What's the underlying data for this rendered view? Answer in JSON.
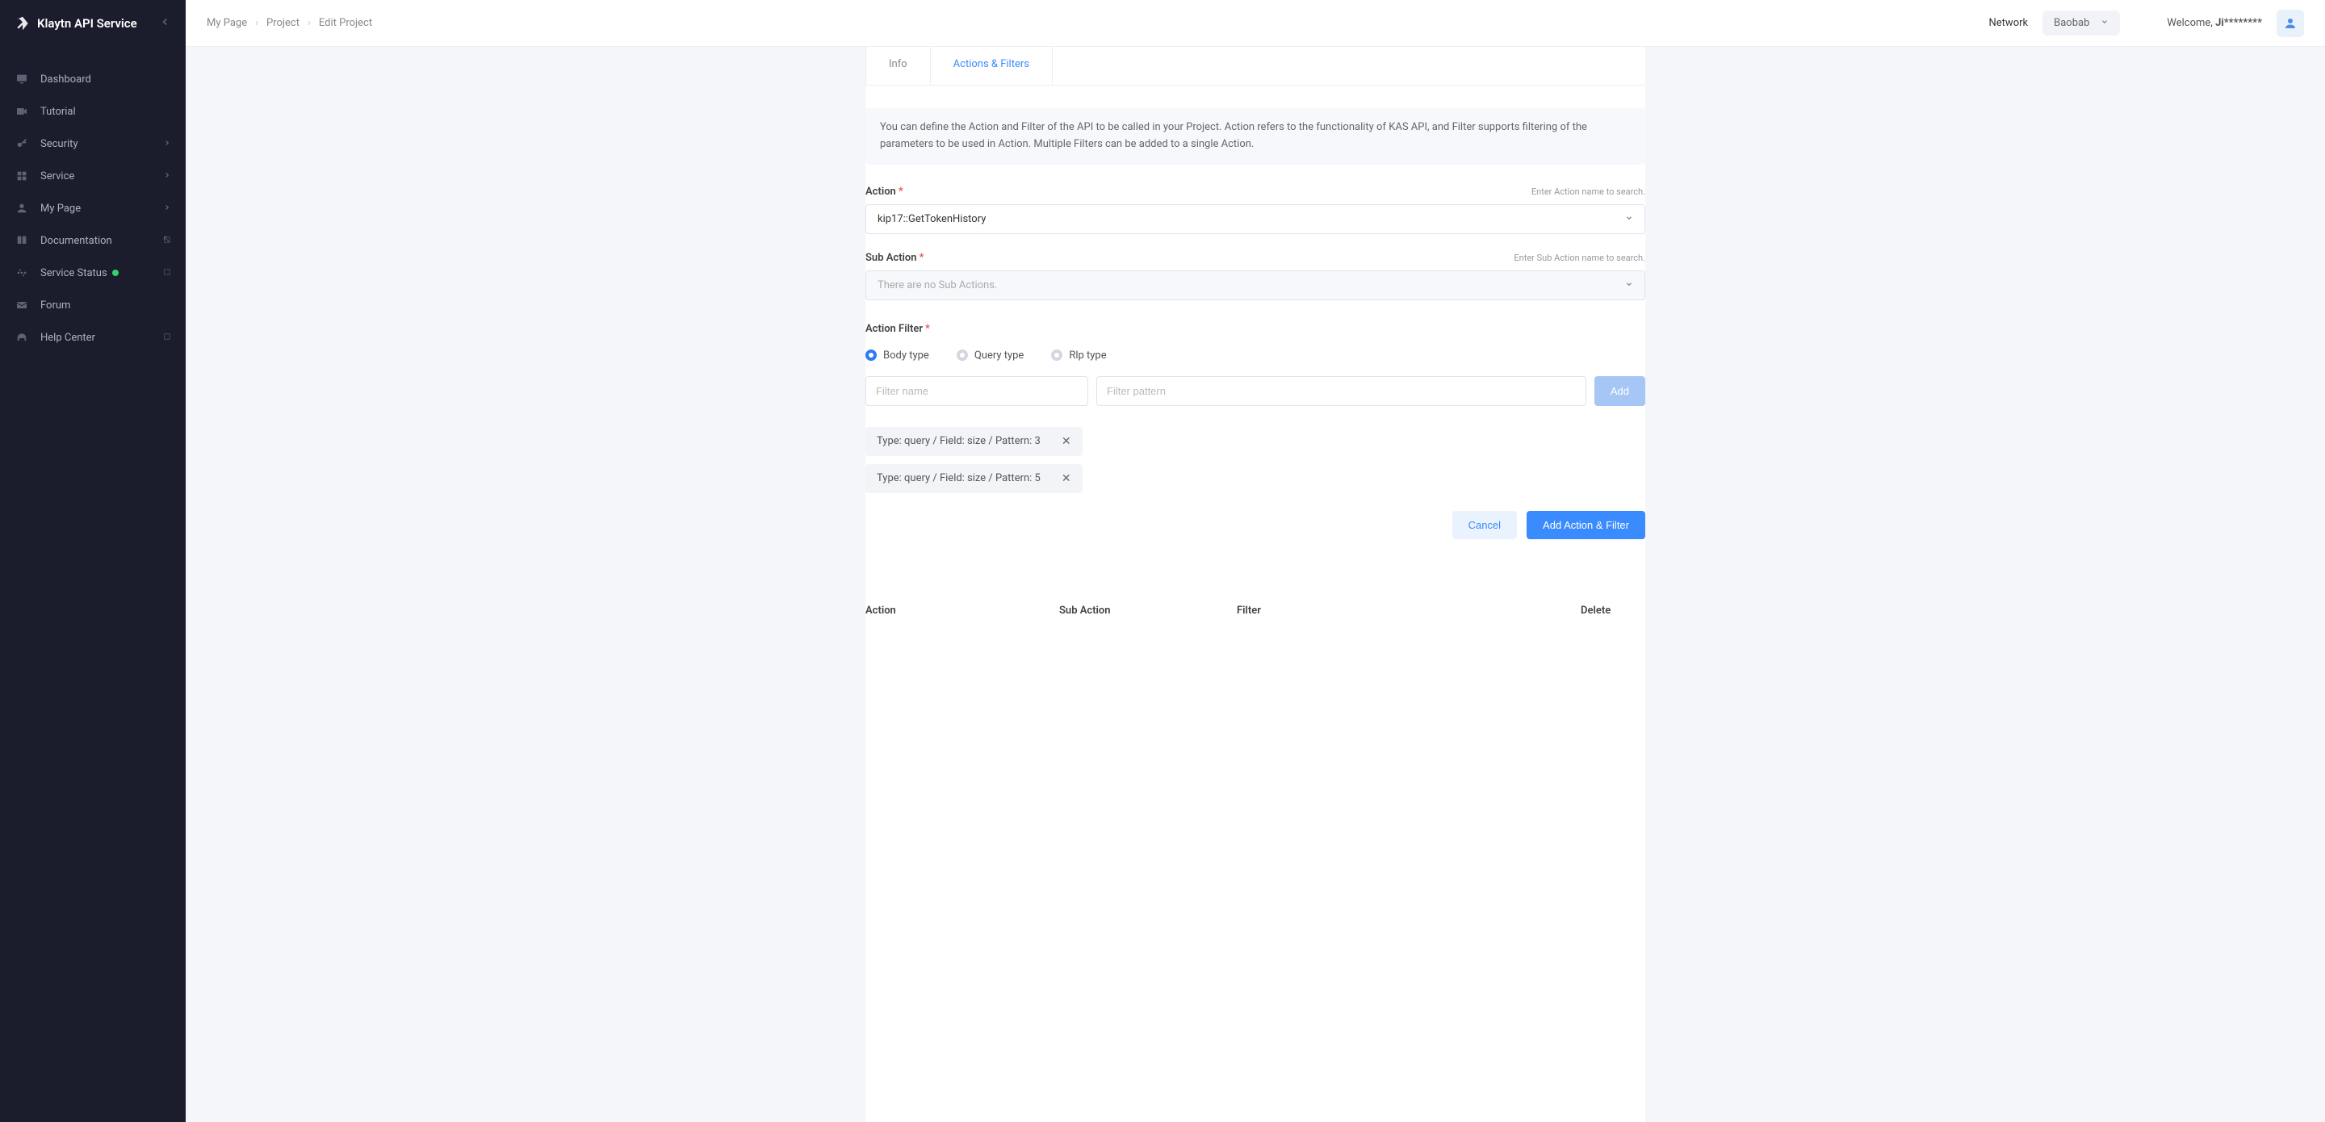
{
  "brand": "Klaytn API Service",
  "sidebar": {
    "items": [
      {
        "label": "Dashboard",
        "icon": "monitor"
      },
      {
        "label": "Tutorial",
        "icon": "video"
      },
      {
        "label": "Security",
        "icon": "key",
        "hasChildren": true
      },
      {
        "label": "Service",
        "icon": "grid",
        "hasChildren": true
      },
      {
        "label": "My Page",
        "icon": "user",
        "hasChildren": true
      },
      {
        "label": "Documentation",
        "icon": "book",
        "external": true
      },
      {
        "label": "Service Status",
        "icon": "activity",
        "external": true,
        "statusDot": true
      },
      {
        "label": "Forum",
        "icon": "mail",
        "external": true
      },
      {
        "label": "Help Center",
        "icon": "headphones",
        "external": true
      }
    ]
  },
  "breadcrumb": [
    "My Page",
    "Project",
    "Edit Project"
  ],
  "topbar": {
    "networkLabel": "Network",
    "networkValue": "Baobab",
    "welcomePrefix": "Welcome, ",
    "username": "Ji********"
  },
  "tabs": {
    "info": "Info",
    "actionsFilters": "Actions & Filters"
  },
  "note": "You can define the Action and Filter of the API to be called in your Project. Action refers to the functionality of KAS API, and Filter supports filtering of the parameters to be used in Action. Multiple Filters can be added to a single Action.",
  "action": {
    "label": "Action",
    "hint": "Enter Action name to search.",
    "value": "kip17::GetTokenHistory"
  },
  "subAction": {
    "label": "Sub Action",
    "hint": "Enter Sub Action name to search.",
    "placeholder": "There are no Sub Actions."
  },
  "actionFilter": {
    "label": "Action Filter",
    "radios": [
      "Body type",
      "Query type",
      "Rlp type"
    ],
    "filterNamePlaceholder": "Filter name",
    "filterPatternPlaceholder": "Filter pattern",
    "addLabel": "Add"
  },
  "chips": [
    "Type: query / Field: size / Pattern: 3",
    "Type: query / Field: size / Pattern: 5"
  ],
  "buttons": {
    "cancel": "Cancel",
    "submit": "Add Action & Filter"
  },
  "table": {
    "action": "Action",
    "subAction": "Sub Action",
    "filter": "Filter",
    "delete": "Delete"
  }
}
